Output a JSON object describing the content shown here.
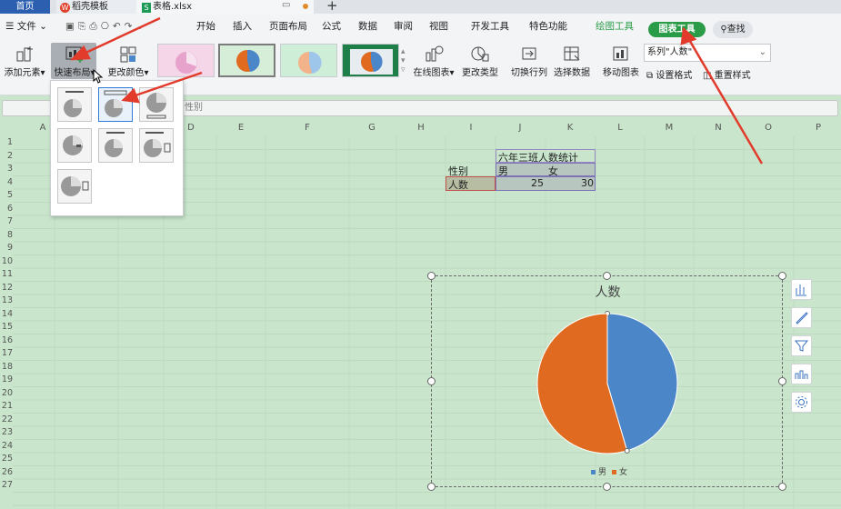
{
  "tabs": {
    "home": "首页",
    "template": "稻壳模板",
    "file": "表格.xlsx"
  },
  "menu": {
    "file": "文件",
    "items": [
      "开始",
      "插入",
      "页面布局",
      "公式",
      "数据",
      "审阅",
      "视图",
      "开发工具",
      "特色功能"
    ],
    "drawing_tools": "绘图工具",
    "chart_tools": "图表工具",
    "search": "查找"
  },
  "ribbon": {
    "add_element": "添加元素",
    "quick_layout": "快速布局",
    "change_color": "更改颜色",
    "online_chart": "在线图表",
    "change_type": "更改类型",
    "switch_rowcol": "切换行列",
    "select_data": "选择数据",
    "move_chart": "移动图表",
    "series_combo": "系列\"人数\"",
    "set_format": "设置格式",
    "reset_style": "重置样式"
  },
  "formula_bar": {
    "value": "性别"
  },
  "columns": [
    "A",
    "B",
    "C",
    "D",
    "E",
    "F",
    "G",
    "H",
    "I",
    "J",
    "K",
    "L",
    "M",
    "N",
    "O",
    "P"
  ],
  "rows": [
    "1",
    "2",
    "3",
    "4",
    "5",
    "6",
    "7",
    "8",
    "9",
    "10",
    "11",
    "12",
    "13",
    "14",
    "15",
    "16",
    "17",
    "18",
    "19",
    "20",
    "21",
    "22",
    "23",
    "24",
    "25",
    "26",
    "27"
  ],
  "sheet": {
    "title": "六年三班人数统计",
    "header_label": "性别",
    "male": "男",
    "female": "女",
    "row_label": "人数",
    "male_value": "25",
    "female_value": "30"
  },
  "chart_data": {
    "type": "pie",
    "title": "人数",
    "categories": [
      "男",
      "女"
    ],
    "values": [
      25,
      30
    ],
    "colors": [
      "#4a86c8",
      "#e06a1f"
    ]
  },
  "colors": {
    "accent_green": "#2a9c48",
    "annotation_red": "#e23b2c",
    "sheet_bg": "#c9e6cc"
  }
}
